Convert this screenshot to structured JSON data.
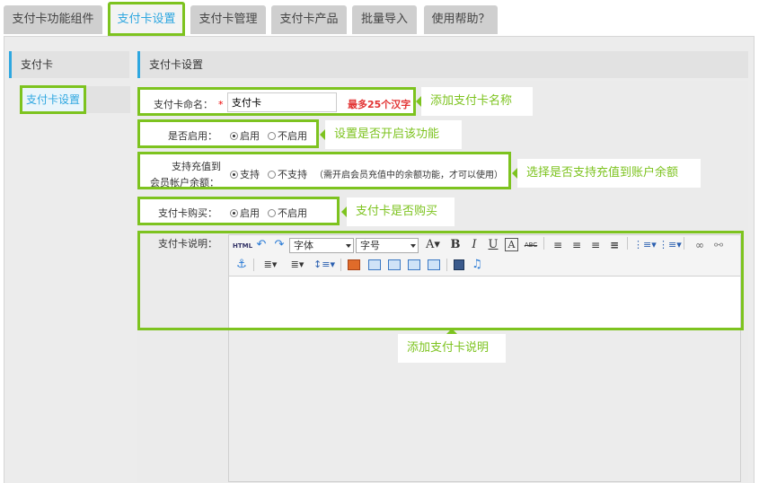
{
  "tabs": [
    {
      "label": "支付卡功能组件",
      "active": false
    },
    {
      "label": "支付卡设置",
      "active": true
    },
    {
      "label": "支付卡管理",
      "active": false
    },
    {
      "label": "支付卡产品",
      "active": false
    },
    {
      "label": "批量导入",
      "active": false
    },
    {
      "label": "使用帮助？",
      "active": false
    }
  ],
  "sidebar": {
    "heading": "支付卡",
    "items": [
      {
        "label": "支付卡设置",
        "selected": true
      }
    ]
  },
  "main": {
    "heading": "支付卡设置",
    "name_field": {
      "label": "支付卡命名：",
      "required_mark": "*",
      "value": "支付卡",
      "hint": "最多25个汉字"
    },
    "enable_field": {
      "label": "是否启用：",
      "options": [
        "启用",
        "不启用"
      ],
      "selected": "启用"
    },
    "recharge_field": {
      "label_line1": "支持充值到",
      "label_line2": "会员帐户余额：",
      "options": [
        "支持",
        "不支持"
      ],
      "selected": "支持",
      "note": "（需开启会员充值中的余额功能，才可以使用）"
    },
    "purchase_field": {
      "label": "支付卡购买：",
      "options": [
        "启用",
        "不启用"
      ],
      "selected": "启用"
    },
    "description_field": {
      "label": "支付卡说明：",
      "toolbar": {
        "html_label": "HTML",
        "font_select": "字体",
        "size_select": "字号",
        "icons": [
          "html-icon",
          "undo-icon",
          "redo-icon",
          "font-color-icon",
          "bold-icon",
          "italic-icon",
          "underline-icon",
          "font-border-icon",
          "strikethrough-icon",
          "align-left-icon",
          "align-center-icon",
          "align-right-icon",
          "align-justify-icon",
          "ordered-list-icon",
          "unordered-list-icon",
          "link-icon",
          "unlink-icon",
          "anchor-icon",
          "line-height-icon",
          "paragraph-spacing-icon",
          "row-spacing-icon",
          "image-icon",
          "image-left-icon",
          "image-center-icon",
          "image-right-icon",
          "image-none-icon",
          "video-icon",
          "music-icon"
        ]
      }
    }
  },
  "callouts": {
    "name": "添加支付卡名称",
    "enable": "设置是否开启该功能",
    "recharge": "选择是否支持充值到账户余额",
    "purchase": "支付卡是否购买",
    "description": "添加支付卡说明"
  },
  "colors": {
    "accent_green": "#7dc31f",
    "accent_blue": "#2ea7e0",
    "hint_red": "#e23333"
  }
}
